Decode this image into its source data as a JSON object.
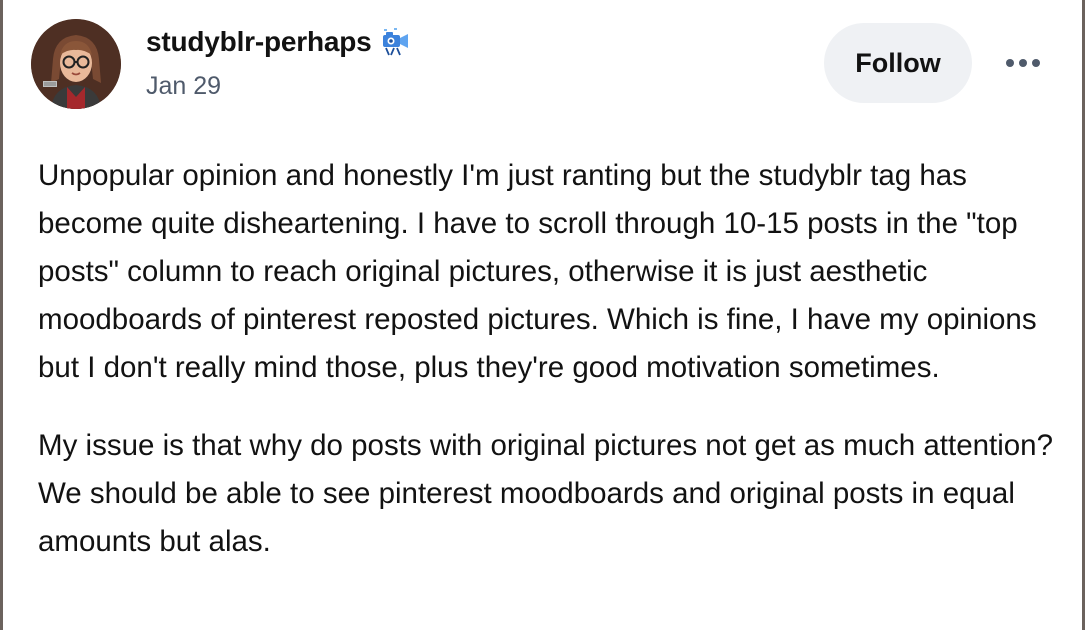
{
  "post": {
    "author": {
      "username": "studyblr-perhaps",
      "badge_icon": "camera-badge-icon",
      "avatar_icon": "avatar-illustration"
    },
    "date": "Jan 29",
    "follow_label": "Follow",
    "more_icon": "more-options-icon",
    "paragraphs": [
      "Unpopular opinion and honestly I'm just ranting but the studyblr tag has become quite disheartening. I have to scroll through 10-15 posts in the \"top posts\" column to reach original pictures, otherwise it is just aesthetic moodboards of pinterest reposted pictures. Which is fine, I have my opinions but I don't really mind those, plus they're good motivation sometimes.",
      "My issue is that why do posts with original pictures not get as much attention? We should be able to see pinterest moodboards and original posts in equal amounts but alas."
    ]
  },
  "colors": {
    "text": "#121212",
    "secondary_text": "#4f5a6b",
    "follow_bg": "#eff1f4",
    "frame": "#6b625d",
    "badge_blue": "#3c82dc"
  }
}
